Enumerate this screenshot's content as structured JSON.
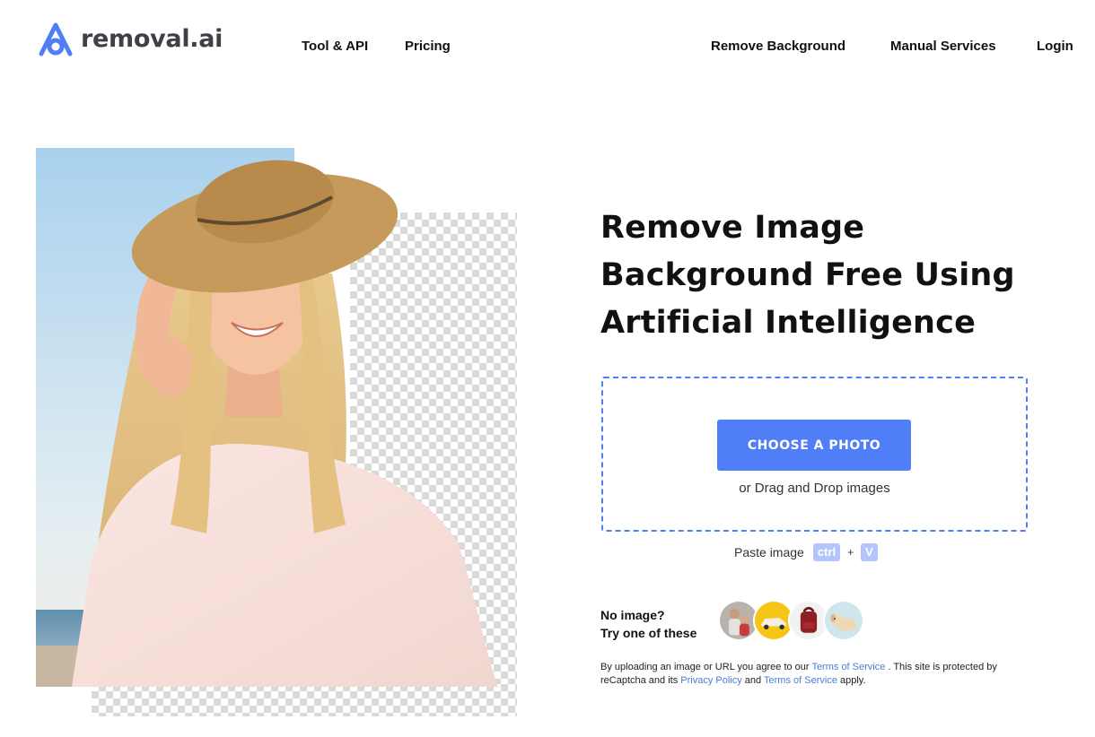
{
  "brand": {
    "name": "removal.ai",
    "accent": "#4f7ef6"
  },
  "nav": {
    "left": [
      "Tool & API",
      "Pricing"
    ],
    "right": [
      "Remove Background",
      "Manual Services",
      "Login"
    ]
  },
  "hero": {
    "title_lines": [
      "Remove Image",
      "Background Free Using",
      "Artificial Intelligence"
    ]
  },
  "upload": {
    "button_label": "CHOOSE A PHOTO",
    "drag_text": "or Drag and Drop images",
    "paste_label": "Paste image",
    "key_ctrl": "ctrl",
    "key_plus": "+",
    "key_v": "V"
  },
  "samples": {
    "line1": "No image?",
    "line2": "Try one of these",
    "items": [
      "family-photo",
      "car-photo",
      "backpack-photo",
      "dog-photo"
    ]
  },
  "legal": {
    "t1": "By uploading an image or URL you agree to our ",
    "terms1": "Terms of Service",
    "t2": " . This site is protected by reCaptcha and its ",
    "privacy": "Privacy Policy",
    "t3": " and ",
    "terms2": "Terms of Service",
    "t4": " apply."
  }
}
